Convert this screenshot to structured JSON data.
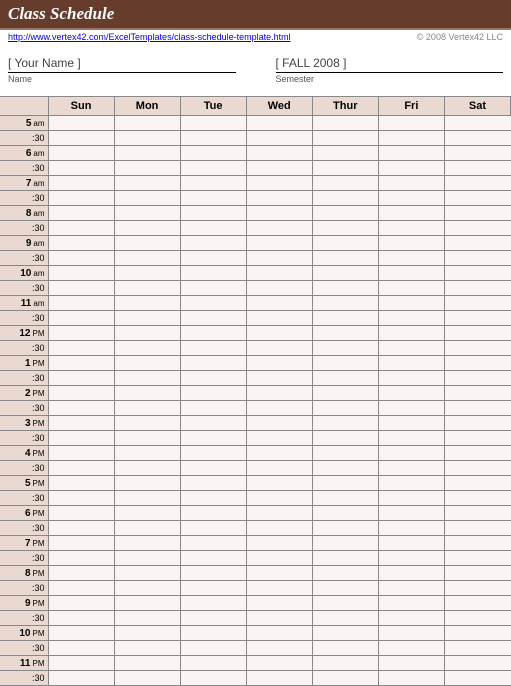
{
  "title": "Class Schedule",
  "url": "http://www.vertex42.com/ExcelTemplates/class-schedule-template.html",
  "copyright": "© 2008 Vertex42 LLC",
  "name_value": "[  Your Name  ]",
  "name_label": "Name",
  "semester_value": "[  FALL 2008  ]",
  "semester_label": "Semester",
  "days": [
    "Sun",
    "Mon",
    "Tue",
    "Wed",
    "Thur",
    "Fri",
    "Sat"
  ],
  "hours": [
    {
      "h": "5",
      "ap": "am"
    },
    {
      "h": "6",
      "ap": "am"
    },
    {
      "h": "7",
      "ap": "am"
    },
    {
      "h": "8",
      "ap": "am"
    },
    {
      "h": "9",
      "ap": "am"
    },
    {
      "h": "10",
      "ap": "am"
    },
    {
      "h": "11",
      "ap": "am"
    },
    {
      "h": "12",
      "ap": "PM"
    },
    {
      "h": "1",
      "ap": "PM"
    },
    {
      "h": "2",
      "ap": "PM"
    },
    {
      "h": "3",
      "ap": "PM"
    },
    {
      "h": "4",
      "ap": "PM"
    },
    {
      "h": "5",
      "ap": "PM"
    },
    {
      "h": "6",
      "ap": "PM"
    },
    {
      "h": "7",
      "ap": "PM"
    },
    {
      "h": "8",
      "ap": "PM"
    },
    {
      "h": "9",
      "ap": "PM"
    },
    {
      "h": "10",
      "ap": "PM"
    },
    {
      "h": "11",
      "ap": "PM"
    }
  ],
  "half_label": ":30"
}
